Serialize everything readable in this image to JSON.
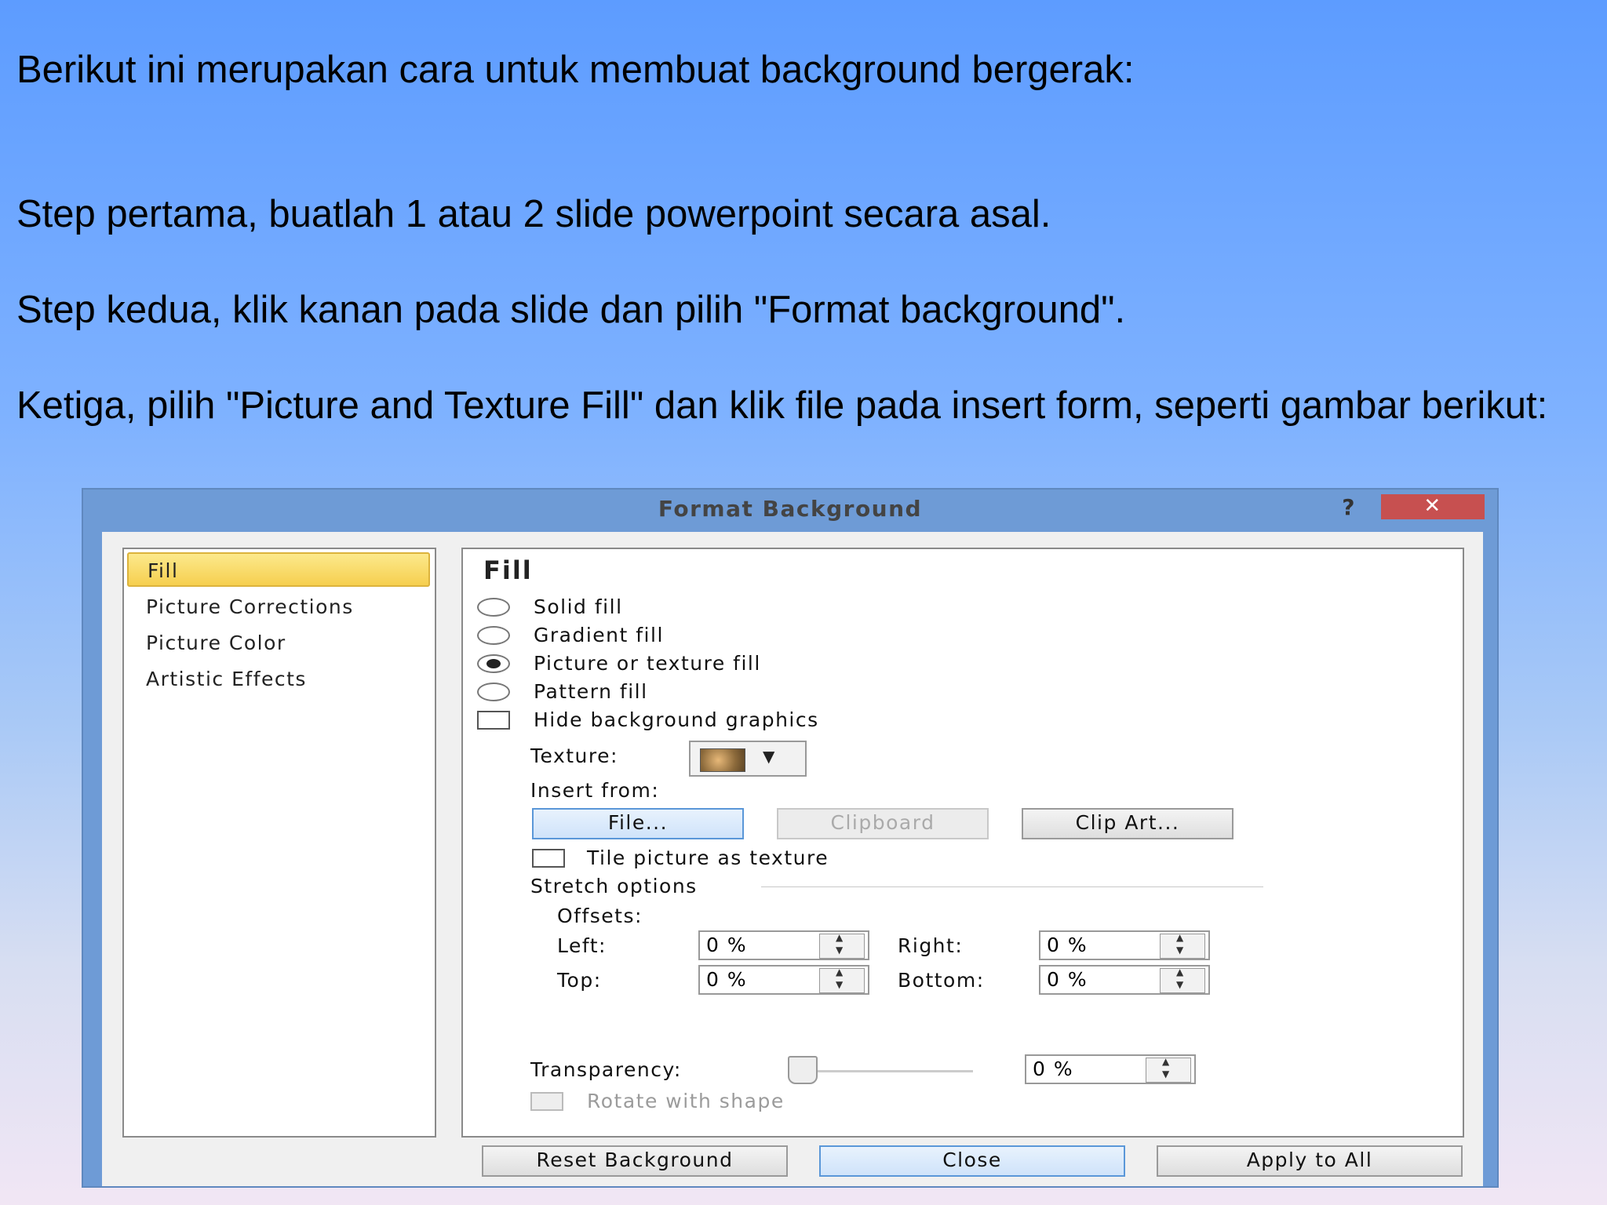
{
  "slide": {
    "lines": [
      "Berikut ini merupakan cara untuk membuat background bergerak:",
      "Step pertama, buatlah 1 atau 2 slide powerpoint secara asal.",
      "Step kedua, klik kanan pada slide dan pilih \"Format background\".",
      "Ketiga, pilih \"Picture and Texture Fill\" dan klik file pada insert form, seperti gambar berikut:"
    ]
  },
  "dialog": {
    "title": "Format Background",
    "help": "?",
    "close_glyph": "✕",
    "nav": [
      "Fill",
      "Picture Corrections",
      "Picture Color",
      "Artistic Effects"
    ],
    "panel_title": "Fill",
    "options": {
      "solid": "Solid fill",
      "gradient": "Gradient fill",
      "picture": "Picture or texture fill",
      "pattern": "Pattern fill",
      "hide": "Hide background graphics"
    },
    "selected_option": "picture",
    "texture_label": "Texture:",
    "insert_from_label": "Insert from:",
    "buttons": {
      "file": "File...",
      "clipboard": "Clipboard",
      "clipart": "Clip Art..."
    },
    "tile_label": "Tile picture as texture",
    "stretch_label": "Stretch options",
    "offsets_label": "Offsets:",
    "left_label": "Left:",
    "left_value": "0 %",
    "right_label": "Right:",
    "right_value": "0 %",
    "top_label": "Top:",
    "top_value": "0 %",
    "bottom_label": "Bottom:",
    "bottom_value": "0 %",
    "transparency_label": "Transparency:",
    "transparency_value": "0 %",
    "transparency_level": 0,
    "rotate_label": "Rotate with shape",
    "footer": {
      "reset": "Reset Background",
      "close": "Close",
      "apply_all": "Apply to All"
    }
  }
}
